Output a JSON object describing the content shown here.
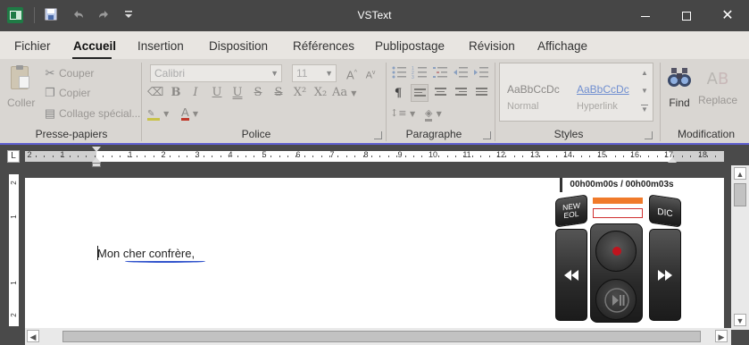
{
  "window": {
    "title": "VSText"
  },
  "titlebar": {
    "app_icon": "excel-like-icon",
    "quick_access": [
      "save-icon",
      "undo-icon",
      "redo-icon",
      "customize-dropdown-icon"
    ],
    "controls": [
      "minimize-icon",
      "maximize-icon",
      "close-icon"
    ]
  },
  "tabs": [
    {
      "label": "Fichier"
    },
    {
      "label": "Accueil"
    },
    {
      "label": "Insertion"
    },
    {
      "label": "Disposition"
    },
    {
      "label": "Références"
    },
    {
      "label": "Publipostage"
    },
    {
      "label": "Révision"
    },
    {
      "label": "Affichage"
    }
  ],
  "ribbon": {
    "clipboard": {
      "group_label": "Presse-papiers",
      "paste_label": "Coller",
      "cut_label": "Couper",
      "copy_label": "Copier",
      "paste_special_label": "Collage spécial..."
    },
    "font": {
      "group_label": "Police",
      "font_name": "Calibri",
      "font_size": "11",
      "bold": "B",
      "italic": "I",
      "underline": "U",
      "double_underline": "U",
      "strike": "S",
      "double_strike": "S",
      "superscript": "X²",
      "subscript": "X₂",
      "case": "Aa",
      "grow": "A",
      "shrink": "A",
      "font_color": "A"
    },
    "paragraph": {
      "group_label": "Paragraphe",
      "show_marks": "¶"
    },
    "styles": {
      "group_label": "Styles",
      "items": [
        {
          "sample": "AaBbCcDc",
          "name": "Normal"
        },
        {
          "sample": "AaBbCcDc",
          "name": "Hyperlink"
        }
      ]
    },
    "modification": {
      "group_label": "Modification",
      "find_label": "Find",
      "replace_label": "Replace"
    }
  },
  "ruler": {
    "numbers": [
      "2",
      "1",
      "1",
      "2",
      "3",
      "4",
      "5",
      "6",
      "7",
      "8",
      "9",
      "10",
      "11",
      "12",
      "13",
      "14",
      "15",
      "16",
      "17",
      "18"
    ],
    "vertical_numbers": [
      "2",
      "1",
      "1",
      "2"
    ]
  },
  "document": {
    "text": "Mon cher confrère,"
  },
  "audio_widget": {
    "time_display": "00h00m00s / 00h00m03s",
    "new_eol_label": "NEW EOL",
    "dic_label": "DIC",
    "rewind_icon": "rewind-icon",
    "forward_icon": "fast-forward-icon",
    "record_icon": "record-icon",
    "play_pause_icon": "play-pause-icon",
    "accent_color": "#f07a2a",
    "record_color": "#c0141e"
  }
}
